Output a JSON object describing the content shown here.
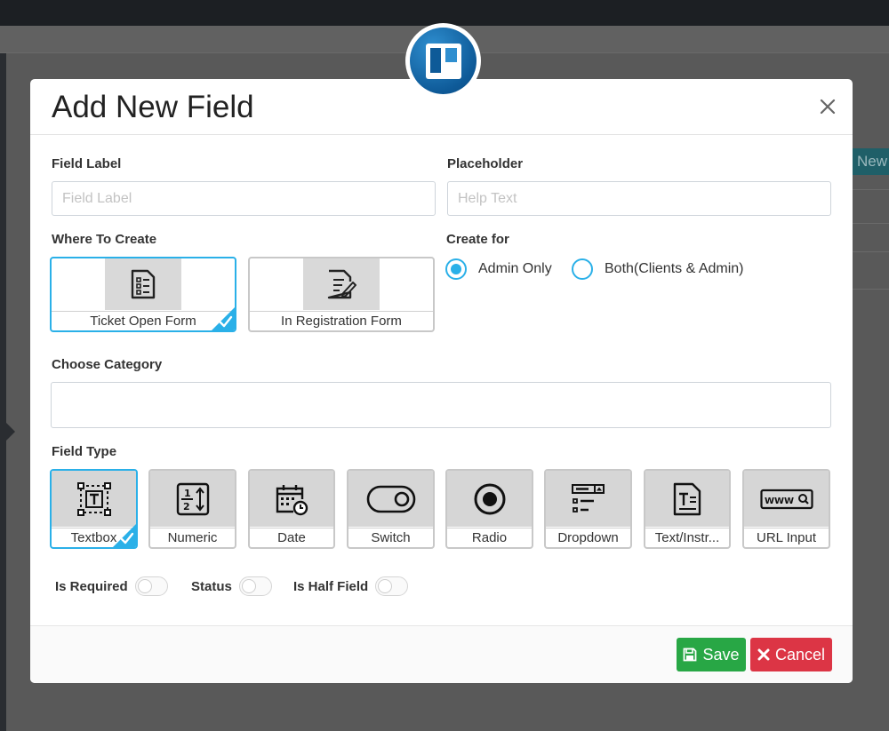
{
  "background": {
    "new_button_label": "New"
  },
  "modal": {
    "title": "Add New Field",
    "field_label": {
      "label": "Field Label",
      "placeholder": "Field Label",
      "value": ""
    },
    "placeholder": {
      "label": "Placeholder",
      "placeholder": "Help Text",
      "value": ""
    },
    "where_to_create": {
      "label": "Where To Create",
      "options": [
        {
          "label": "Ticket Open Form",
          "icon": "form-document-icon",
          "selected": true
        },
        {
          "label": "In Registration Form",
          "icon": "form-edit-icon",
          "selected": false
        }
      ]
    },
    "create_for": {
      "label": "Create for",
      "options": [
        {
          "label": "Admin Only",
          "selected": true
        },
        {
          "label": "Both(Clients & Admin)",
          "selected": false
        }
      ]
    },
    "choose_category": {
      "label": "Choose Category",
      "value": ""
    },
    "field_type": {
      "label": "Field Type",
      "options": [
        {
          "label": "Textbox",
          "icon": "textbox-icon",
          "selected": true
        },
        {
          "label": "Numeric",
          "icon": "numeric-icon",
          "selected": false
        },
        {
          "label": "Date",
          "icon": "calendar-icon",
          "selected": false
        },
        {
          "label": "Switch",
          "icon": "switch-icon",
          "selected": false
        },
        {
          "label": "Radio",
          "icon": "radio-icon",
          "selected": false
        },
        {
          "label": "Dropdown",
          "icon": "dropdown-icon",
          "selected": false
        },
        {
          "label": "Text/Instr...",
          "icon": "text-instruction-icon",
          "selected": false
        },
        {
          "label": "URL Input",
          "icon": "url-input-icon",
          "selected": false
        }
      ]
    },
    "toggles": [
      {
        "label": "Is Required",
        "on": false
      },
      {
        "label": "Status",
        "on": false
      },
      {
        "label": "Is Half Field",
        "on": false
      }
    ],
    "footer": {
      "save_label": "Save",
      "cancel_label": "Cancel"
    }
  },
  "colors": {
    "accent": "#2ab0e8",
    "save": "#28a745",
    "cancel": "#dc3545"
  }
}
